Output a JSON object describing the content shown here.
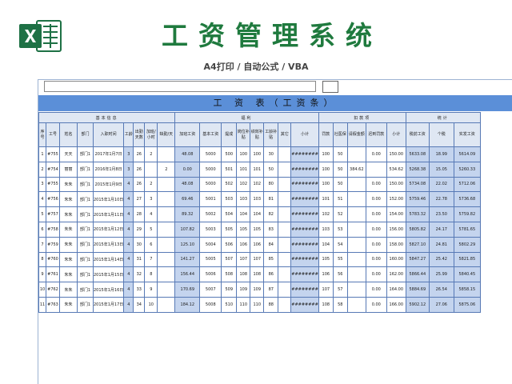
{
  "header": {
    "title": "工资管理系统",
    "subtitle": "A4打印 / 自动公式 / VBA"
  },
  "colors": {
    "brand_green": "#1f7a3e",
    "title_bar": "#5b8fd8",
    "highlight": "#c4d4ee",
    "border": "#5779b5"
  },
  "sheet": {
    "title": "工 资 表（工资条）",
    "groups": {
      "basic": "基本信息",
      "welfare": "福利",
      "deduction": "扣款项",
      "statistics": "统计"
    },
    "columns": [
      "序号",
      "工号",
      "姓名",
      "部门",
      "入职时间",
      "工龄",
      "出勤天数",
      "加班/小时",
      "缺勤/天",
      "加班工资",
      "基本工资",
      "提成",
      "岗位补贴",
      "绩效补贴",
      "工龄补贴",
      "其它",
      "小计",
      "罚款",
      "社医保",
      "请假金额",
      "迟到罚款",
      "小计",
      "税前工资",
      "个税",
      "实发工资"
    ],
    "rows": [
      [
        "1",
        "#755",
        "天天",
        "部门1",
        "2017年1月7日",
        "3",
        "26",
        "2",
        "",
        "48.08",
        "5000",
        "500",
        "100",
        "100",
        "30",
        "",
        "########",
        "100",
        "50",
        "",
        "0.00",
        "",
        "150.00",
        "5633.08",
        "18.99",
        "5614.09"
      ],
      [
        "2",
        "#754",
        "丽丽",
        "部门1",
        "2016年1月8日",
        "3",
        "26",
        "",
        "2",
        "0.00",
        "5000",
        "501",
        "101",
        "101",
        "50",
        "",
        "########",
        "100",
        "50",
        "384.62",
        "",
        "",
        "534.62",
        "5268.38",
        "15.05",
        "5260.33"
      ],
      [
        "3",
        "#755",
        "朱朱",
        "部门1",
        "2015年1月9日",
        "4",
        "26",
        "2",
        "",
        "48.08",
        "5000",
        "502",
        "102",
        "102",
        "80",
        "",
        "########",
        "100",
        "50",
        "",
        "0.00",
        "",
        "150.00",
        "5734.08",
        "22.02",
        "5712.06"
      ],
      [
        "4",
        "#756",
        "朱朱",
        "部门1",
        "2015年1月10日",
        "4",
        "27",
        "3",
        "",
        "69.46",
        "5001",
        "503",
        "103",
        "103",
        "81",
        "",
        "########",
        "101",
        "51",
        "",
        "0.00",
        "",
        "152.00",
        "5759.46",
        "22.78",
        "5736.68"
      ],
      [
        "5",
        "#757",
        "朱朱",
        "部门1",
        "2015年1月11日",
        "4",
        "28",
        "4",
        "",
        "89.32",
        "5002",
        "504",
        "104",
        "104",
        "82",
        "",
        "########",
        "102",
        "52",
        "",
        "0.00",
        "",
        "154.00",
        "5783.32",
        "23.50",
        "5759.82"
      ],
      [
        "6",
        "#758",
        "朱朱",
        "部门1",
        "2015年1月12日",
        "4",
        "29",
        "5",
        "",
        "107.82",
        "5003",
        "505",
        "105",
        "105",
        "83",
        "",
        "########",
        "103",
        "53",
        "",
        "0.00",
        "",
        "156.00",
        "5805.82",
        "24.17",
        "5781.65"
      ],
      [
        "7",
        "#759",
        "朱朱",
        "部门1",
        "2015年1月13日",
        "4",
        "30",
        "6",
        "",
        "125.10",
        "5004",
        "506",
        "106",
        "106",
        "84",
        "",
        "########",
        "104",
        "54",
        "",
        "0.00",
        "",
        "158.00",
        "5827.10",
        "24.81",
        "5802.29"
      ],
      [
        "8",
        "#760",
        "朱朱",
        "部门1",
        "2015年1月14日",
        "4",
        "31",
        "7",
        "",
        "141.27",
        "5005",
        "507",
        "107",
        "107",
        "85",
        "",
        "########",
        "105",
        "55",
        "",
        "0.00",
        "",
        "160.00",
        "5847.27",
        "25.42",
        "5821.85"
      ],
      [
        "9",
        "#761",
        "朱朱",
        "部门1",
        "2015年1月15日",
        "4",
        "32",
        "8",
        "",
        "156.44",
        "5006",
        "508",
        "108",
        "108",
        "86",
        "",
        "########",
        "106",
        "56",
        "",
        "0.00",
        "",
        "162.00",
        "5866.44",
        "25.99",
        "5840.45"
      ],
      [
        "10",
        "#762",
        "朱朱",
        "部门1",
        "2015年1月16日",
        "4",
        "33",
        "9",
        "",
        "170.69",
        "5007",
        "509",
        "109",
        "109",
        "87",
        "",
        "########",
        "107",
        "57",
        "",
        "0.00",
        "",
        "164.00",
        "5884.69",
        "26.54",
        "5858.15"
      ],
      [
        "11",
        "#763",
        "朱朱",
        "部门1",
        "2015年1月17日",
        "4",
        "34",
        "10",
        "",
        "184.12",
        "5008",
        "510",
        "110",
        "110",
        "88",
        "",
        "########",
        "108",
        "58",
        "",
        "0.00",
        "",
        "166.00",
        "5902.12",
        "27.06",
        "5875.06"
      ]
    ]
  }
}
